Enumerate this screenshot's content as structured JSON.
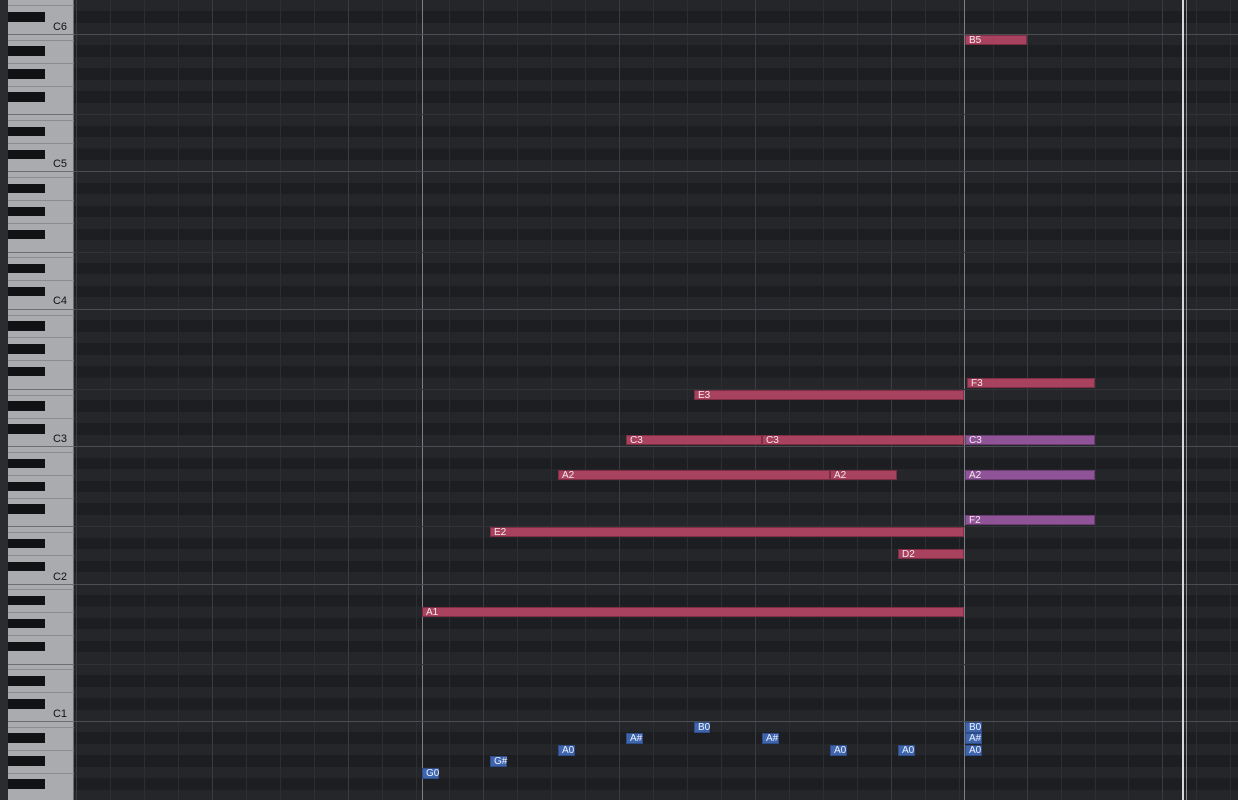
{
  "keyboard": {
    "octave_labels": [
      "C6",
      "C5",
      "C4",
      "C3",
      "C2",
      "C1"
    ]
  },
  "notes": [
    {
      "label": "B5",
      "color": "red"
    },
    {
      "label": "F3",
      "color": "red"
    },
    {
      "label": "E3",
      "color": "red"
    },
    {
      "label": "C3",
      "color": "red"
    },
    {
      "label": "C3",
      "color": "red"
    },
    {
      "label": "C3",
      "color": "purple"
    },
    {
      "label": "A2",
      "color": "red"
    },
    {
      "label": "A2",
      "color": "red"
    },
    {
      "label": "A2",
      "color": "purple"
    },
    {
      "label": "F2",
      "color": "purple"
    },
    {
      "label": "E2",
      "color": "red"
    },
    {
      "label": "D2",
      "color": "red"
    },
    {
      "label": "A1",
      "color": "red"
    },
    {
      "label": "B0",
      "color": "blue"
    },
    {
      "label": "B0",
      "color": "blue"
    },
    {
      "label": "A#",
      "color": "blue"
    },
    {
      "label": "A#",
      "color": "blue"
    },
    {
      "label": "A#",
      "color": "blue"
    },
    {
      "label": "A0",
      "color": "blue"
    },
    {
      "label": "A0",
      "color": "blue"
    },
    {
      "label": "A0",
      "color": "blue"
    },
    {
      "label": "A0",
      "color": "blue"
    },
    {
      "label": "G#",
      "color": "blue"
    },
    {
      "label": "G0",
      "color": "blue"
    }
  ],
  "colors": {
    "note_red": "#a8425e",
    "note_purple": "#8e5497",
    "note_blue": "#3f66ad",
    "background": "#1f2124"
  }
}
